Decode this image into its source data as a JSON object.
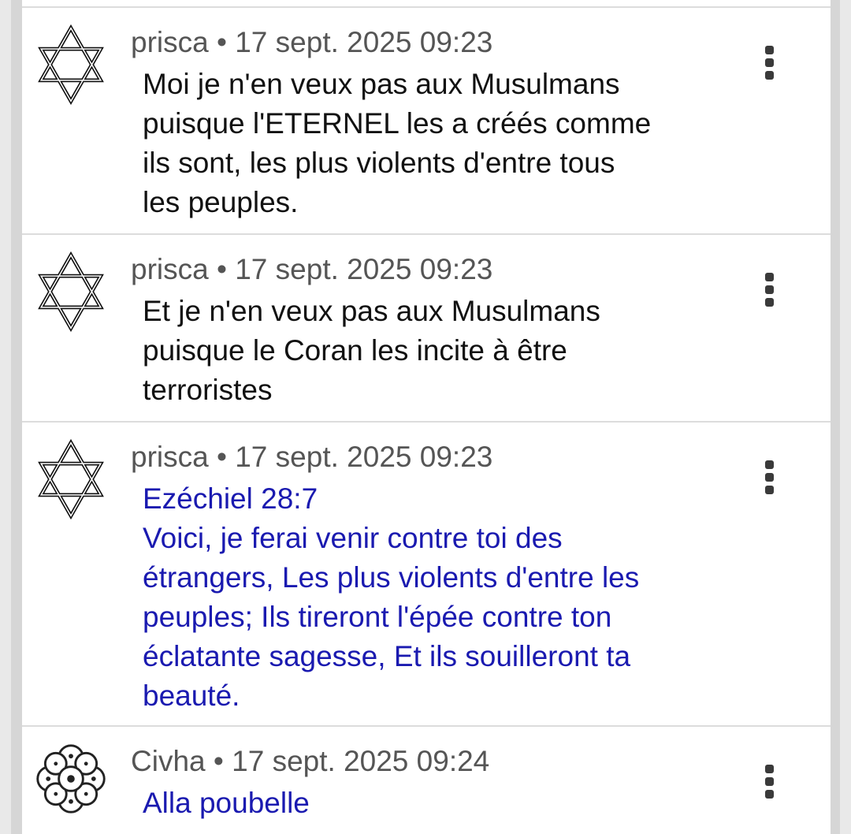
{
  "comments": [
    {
      "author": "prisca",
      "separator": "•",
      "timestamp": "17 sept. 2025 09:23",
      "avatar_icon": "star-of-david-icon",
      "lines": [
        "Moi je n'en veux pas aux Musulmans",
        "puisque l'ETERNEL les a créés comme",
        "ils sont, les plus violents d'entre tous",
        "les peuples."
      ]
    },
    {
      "author": "prisca",
      "separator": "•",
      "timestamp": "17 sept. 2025 09:23",
      "avatar_icon": "star-of-david-icon",
      "lines": [
        "Et je n'en veux pas aux Musulmans",
        "puisque le Coran les incite à être",
        "terroristes"
      ]
    },
    {
      "author": "prisca",
      "separator": "•",
      "timestamp": "17 sept. 2025 09:23",
      "avatar_icon": "star-of-david-icon",
      "lines": [
        "Ezéchiel 28:7",
        "Voici, je ferai venir contre toi des",
        "étrangers, Les plus violents d'entre les",
        "peuples; Ils tireront l'épée contre ton",
        "éclatante sagesse, Et ils souilleront ta",
        "beauté."
      ]
    },
    {
      "author": "Civha",
      "separator": "•",
      "timestamp": "17 sept. 2025 09:24",
      "avatar_icon": "lotus-mandala-icon",
      "lines": [
        "Alla poubelle"
      ]
    }
  ],
  "colors": {
    "quote_text": "#1a1ab0",
    "body_text": "#111111",
    "meta_text": "#555555"
  },
  "more_icon": "more-vertical-icon"
}
